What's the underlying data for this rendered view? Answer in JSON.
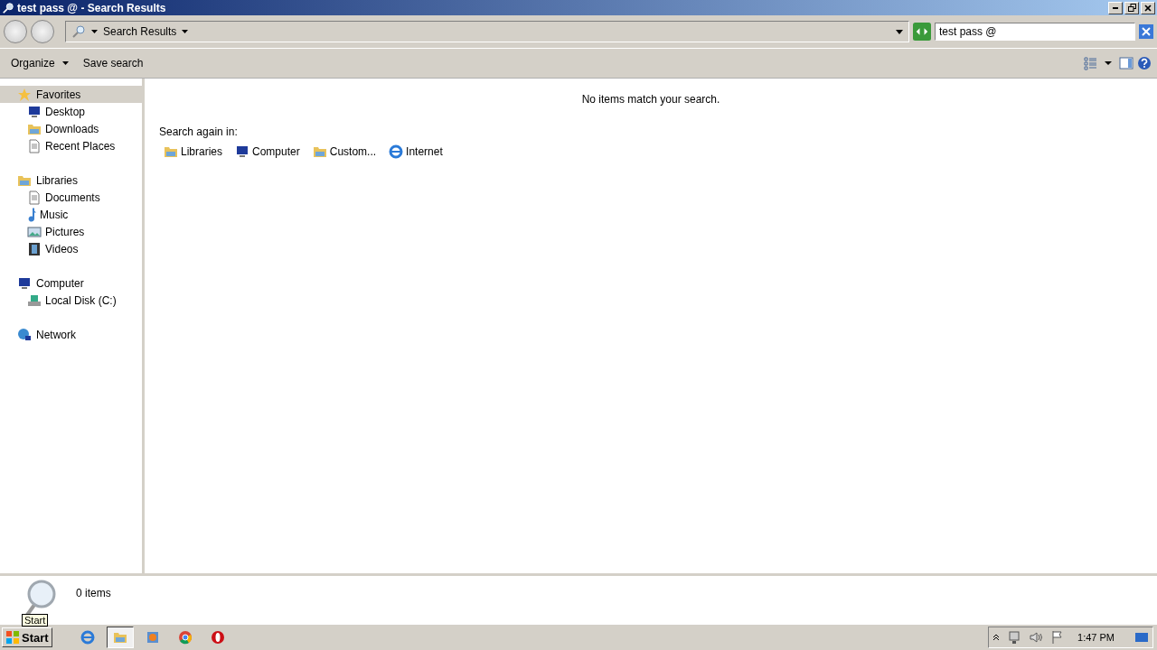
{
  "window": {
    "title": "test pass @ - Search Results"
  },
  "address": {
    "breadcrumb": "Search Results"
  },
  "search": {
    "value": "test pass @"
  },
  "command_bar": {
    "items": [
      "Organize",
      "Save search"
    ]
  },
  "sidebar": {
    "groups": [
      {
        "label": "Favorites",
        "selected": true,
        "children": [
          {
            "label": "Desktop",
            "selected": false
          },
          {
            "label": "Downloads",
            "selected": false
          },
          {
            "label": "Recent Places",
            "selected": false
          }
        ]
      },
      {
        "label": "Libraries",
        "selected": false,
        "children": [
          {
            "label": "Documents",
            "selected": false
          },
          {
            "label": "Music",
            "selected": false
          },
          {
            "label": "Pictures",
            "selected": false
          },
          {
            "label": "Videos",
            "selected": false
          }
        ]
      },
      {
        "label": "Computer",
        "selected": false,
        "children": [
          {
            "label": "Local Disk (C:)",
            "selected": false
          }
        ]
      },
      {
        "label": "Network",
        "selected": false
      }
    ]
  },
  "content": {
    "message": "No items match your search.",
    "search_again_label": "Search again in:",
    "locations": [
      "Libraries",
      "Computer",
      "Custom...",
      "Internet"
    ]
  },
  "status_bar": {
    "count": "0 items"
  },
  "tooltip": {
    "text": "Start"
  },
  "taskbar": {
    "start": "Start",
    "tasks": [
      {
        "selected": false
      },
      {
        "selected": true
      },
      {
        "selected": false
      },
      {
        "selected": false
      },
      {
        "selected": false
      }
    ],
    "clock": "1:47 PM"
  }
}
